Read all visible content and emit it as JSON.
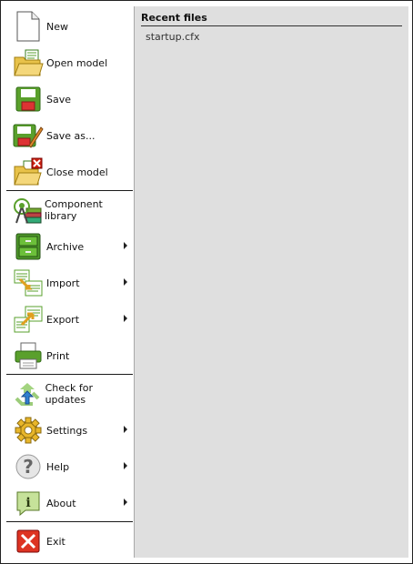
{
  "menu": {
    "items": [
      {
        "label": "New",
        "icon": "new-document-icon",
        "submenu": false
      },
      {
        "label": "Open model",
        "icon": "open-folder-icon",
        "submenu": false
      },
      {
        "label": "Save",
        "icon": "save-icon",
        "submenu": false
      },
      {
        "label": "Save as...",
        "icon": "save-as-icon",
        "submenu": false
      },
      {
        "label": "Close model",
        "icon": "close-folder-icon",
        "submenu": false
      },
      {
        "label": "Component library",
        "icon": "component-library-icon",
        "submenu": false
      },
      {
        "label": "Archive",
        "icon": "archive-cabinet-icon",
        "submenu": true
      },
      {
        "label": "Import",
        "icon": "import-icon",
        "submenu": true
      },
      {
        "label": "Export",
        "icon": "export-icon",
        "submenu": true
      },
      {
        "label": "Print",
        "icon": "printer-icon",
        "submenu": false
      },
      {
        "label": "Check for updates",
        "icon": "update-recycle-icon",
        "submenu": false
      },
      {
        "label": "Settings",
        "icon": "gear-icon",
        "submenu": true
      },
      {
        "label": "Help",
        "icon": "question-icon",
        "submenu": true
      },
      {
        "label": "About",
        "icon": "info-icon",
        "submenu": true
      },
      {
        "label": "Exit",
        "icon": "exit-x-icon",
        "submenu": false
      }
    ]
  },
  "recent": {
    "title": "Recent files",
    "files": [
      "startup.cfx"
    ]
  },
  "colors": {
    "panel_bg": "#dfdfdf",
    "green": "#5aa02c",
    "folder": "#e8c24a",
    "red": "#d22",
    "blue": "#2f7fd0"
  }
}
